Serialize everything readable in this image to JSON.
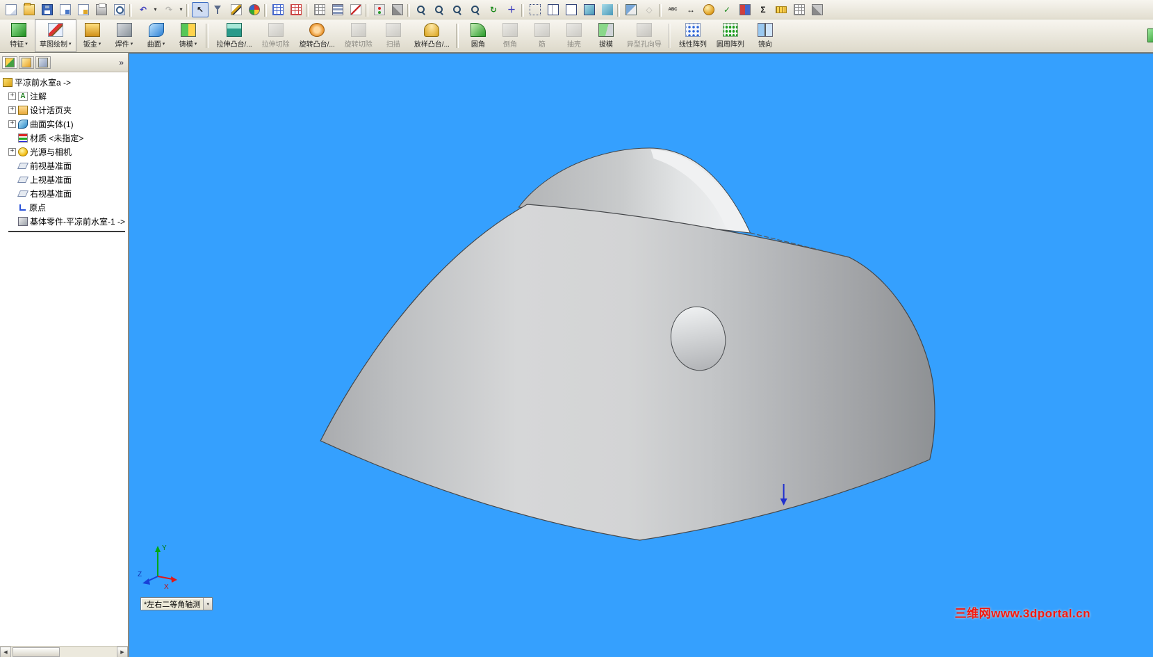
{
  "colors": {
    "viewport_bg": "#35a0fe",
    "watermark_red": "#f5190f",
    "toolbar_bg": "#ece9d8",
    "model_gray": "#c6c8ca"
  },
  "toolbar_main": {
    "items": [
      {
        "name": "new-document-button",
        "icon": "page",
        "icon_name": "new-document-icon"
      },
      {
        "name": "open-button",
        "icon": "folder",
        "icon_name": "open-folder-icon"
      },
      {
        "name": "save-button",
        "icon": "floppy",
        "icon_name": "save-icon"
      },
      {
        "name": "make-drawing-button",
        "icon": "page-blue",
        "icon_name": "make-drawing-icon"
      },
      {
        "name": "make-assembly-button",
        "icon": "page-gold",
        "icon_name": "make-assembly-icon"
      },
      {
        "name": "print-button",
        "icon": "printer",
        "icon_name": "print-icon"
      },
      {
        "name": "print-preview-button",
        "icon": "preview",
        "icon_name": "print-preview-icon",
        "sep": true
      },
      {
        "name": "undo-button",
        "icon": "none",
        "icon_name": "undo-icon",
        "glyph": "↶",
        "g": "blue",
        "caret": true
      },
      {
        "name": "redo-button",
        "icon": "none",
        "icon_name": "redo-icon",
        "glyph": "↷",
        "g": "gray",
        "caret": true,
        "state": "disabled",
        "sep": true
      },
      {
        "name": "select-button",
        "icon": "none",
        "icon_name": "select-arrow-icon",
        "glyph": "↖",
        "g": "dark",
        "pressed": true
      },
      {
        "name": "selection-filter-button",
        "icon": "funnel",
        "icon_name": "selection-filter-icon"
      },
      {
        "name": "sketch-entity-button",
        "icon": "pencil",
        "icon_name": "pencil-icon"
      },
      {
        "name": "color-button",
        "icon": "palette",
        "icon_name": "color-palette-icon",
        "sep": true
      },
      {
        "name": "design-table-button",
        "icon": "grid-blue",
        "icon_name": "design-table-icon"
      },
      {
        "name": "hole-table-button",
        "icon": "grid-red",
        "icon_name": "hole-table-icon",
        "sep": true
      },
      {
        "name": "equations-table-button",
        "icon": "grid-gray",
        "icon_name": "equations-table-icon"
      },
      {
        "name": "layers-button",
        "icon": "layers",
        "icon_name": "layers-icon"
      },
      {
        "name": "line-format-button",
        "icon": "diag",
        "icon_name": "line-format-icon",
        "sep": true
      },
      {
        "name": "rebuild-button",
        "icon": "rebuild",
        "icon_name": "rebuild-stoplight-icon"
      },
      {
        "name": "options-button",
        "icon": "hammer",
        "icon_name": "options-tools-icon",
        "sep": true
      },
      {
        "name": "zoom-previous-button",
        "icon": "mag",
        "icon_name": "zoom-previous-icon"
      },
      {
        "name": "zoom-to-fit-button",
        "icon": "mag",
        "icon_name": "zoom-to-fit-icon"
      },
      {
        "name": "zoom-to-area-button",
        "icon": "mag",
        "icon_name": "zoom-to-area-icon"
      },
      {
        "name": "zoom-in-out-button",
        "icon": "mag",
        "icon_name": "zoom-in-out-icon"
      },
      {
        "name": "rotate-view-button",
        "icon": "none",
        "icon_name": "rotate-view-icon",
        "glyph": "↻",
        "g": "green"
      },
      {
        "name": "pan-button",
        "icon": "none",
        "icon_name": "pan-icon",
        "glyph": "＋",
        "g": "blue",
        "sep": true
      },
      {
        "name": "wireframe-button",
        "icon": "box-wire",
        "icon_name": "wireframe-icon"
      },
      {
        "name": "hidden-lines-visible-button",
        "icon": "box-hlv",
        "icon_name": "hidden-lines-visible-icon"
      },
      {
        "name": "hidden-lines-removed-button",
        "icon": "box-hlr",
        "icon_name": "hidden-lines-removed-icon"
      },
      {
        "name": "shaded-with-edges-button",
        "icon": "box-shaded-e",
        "icon_name": "shaded-with-edges-icon"
      },
      {
        "name": "shaded-button",
        "icon": "box-shaded",
        "icon_name": "shaded-icon",
        "sep": true
      },
      {
        "name": "section-view-button",
        "icon": "section",
        "icon_name": "section-view-icon"
      },
      {
        "name": "perspective-button",
        "icon": "none",
        "icon_name": "perspective-icon",
        "glyph": "◇",
        "g": "gray",
        "state": "disabled",
        "sep": true
      },
      {
        "name": "spell-check-button",
        "icon": "abc",
        "icon_name": "spell-check-icon",
        "glyph": "ABC",
        "g": "dark"
      },
      {
        "name": "dimension-button",
        "icon": "none",
        "icon_name": "dimension-icon",
        "glyph": "↔",
        "g": "dark"
      },
      {
        "name": "appearance-button",
        "icon": "sphere",
        "icon_name": "appearance-sphere-icon"
      },
      {
        "name": "design-check-button",
        "icon": "none",
        "icon_name": "check-mark-icon",
        "glyph": "✓",
        "g": "green"
      },
      {
        "name": "swap-color-button",
        "icon": "redblue",
        "icon_name": "two-color-icon"
      },
      {
        "name": "equations-button",
        "icon": "none",
        "icon_name": "sigma-icon",
        "glyph": "Σ",
        "g": "dark"
      },
      {
        "name": "measure-button",
        "icon": "ruler",
        "icon_name": "measure-ruler-icon"
      },
      {
        "name": "mass-properties-button",
        "icon": "grid-gray",
        "icon_name": "mass-properties-icon"
      },
      {
        "name": "toolbox-button",
        "icon": "hammer",
        "icon_name": "toolbox-hammer-icon"
      }
    ]
  },
  "command_bar": {
    "tabs": [
      {
        "name": "tab-features",
        "label": "特征",
        "icon": "features",
        "icon_name": "features-icon",
        "caret": true
      },
      {
        "name": "tab-sketch",
        "label": "草图绘制",
        "icon": "sketch",
        "icon_name": "sketch-icon",
        "caret": true,
        "active": true
      },
      {
        "name": "tab-sheet-metal",
        "label": "钣金",
        "icon": "sheetmetal",
        "icon_name": "sheet-metal-icon",
        "caret": true
      },
      {
        "name": "tab-weldments",
        "label": "焊件",
        "icon": "weldments",
        "icon_name": "weldments-icon",
        "caret": true
      },
      {
        "name": "tab-surfaces",
        "label": "曲面",
        "icon": "surfaces",
        "icon_name": "surfaces-icon",
        "caret": true
      },
      {
        "name": "tab-mold",
        "label": "铸模",
        "icon": "mold",
        "icon_name": "mold-tools-icon",
        "caret": true,
        "sep": true
      }
    ],
    "commands": [
      {
        "name": "extruded-boss-button",
        "label": "拉伸凸台/...",
        "icon": "extrude-boss",
        "icon_name": "extruded-boss-icon"
      },
      {
        "name": "extruded-cut-button",
        "label": "拉伸切除",
        "icon": "generic",
        "icon_name": "extruded-cut-icon",
        "state": "disabled"
      },
      {
        "name": "revolved-boss-button",
        "label": "旋转凸台/...",
        "icon": "revolve-boss",
        "icon_name": "revolved-boss-icon"
      },
      {
        "name": "revolved-cut-button",
        "label": "旋转切除",
        "icon": "generic",
        "icon_name": "revolved-cut-icon",
        "state": "disabled"
      },
      {
        "name": "sweep-button",
        "label": "扫描",
        "icon": "generic",
        "icon_name": "sweep-icon",
        "state": "disabled"
      },
      {
        "name": "loft-button",
        "label": "放样凸台/...",
        "icon": "loft",
        "icon_name": "loft-icon",
        "sep": true
      },
      {
        "name": "fillet-button",
        "label": "圆角",
        "icon": "fillet",
        "icon_name": "fillet-icon"
      },
      {
        "name": "chamfer-button",
        "label": "倒角",
        "icon": "generic",
        "icon_name": "chamfer-icon",
        "state": "disabled"
      },
      {
        "name": "rib-button",
        "label": "筋",
        "icon": "generic",
        "icon_name": "rib-icon",
        "state": "disabled"
      },
      {
        "name": "shell-button",
        "label": "抽壳",
        "icon": "generic",
        "icon_name": "shell-icon",
        "state": "disabled"
      },
      {
        "name": "draft-button",
        "label": "拔模",
        "icon": "draft",
        "icon_name": "draft-icon"
      },
      {
        "name": "hole-wizard-button",
        "label": "异型孔向导",
        "icon": "holewiz",
        "icon_name": "hole-wizard-icon",
        "state": "disabled",
        "sep": true
      },
      {
        "name": "linear-pattern-button",
        "label": "线性阵列",
        "icon": "linear-pattern",
        "icon_name": "linear-pattern-icon"
      },
      {
        "name": "circular-pattern-button",
        "label": "圆周阵列",
        "icon": "circular-pattern",
        "icon_name": "circular-pattern-icon"
      },
      {
        "name": "mirror-button",
        "label": "镜向",
        "icon": "mirror",
        "icon_name": "mirror-icon"
      },
      {
        "name": "clipped-command-button",
        "label": "",
        "icon": "features",
        "icon_name": "clipped-command-icon",
        "clipped": true
      }
    ]
  },
  "panel": {
    "tabs": [
      {
        "name": "featuremanager-tab",
        "icon": "fm",
        "icon_name": "featuremanager-tree-icon",
        "active": true
      },
      {
        "name": "propertymanager-tab",
        "icon": "pm",
        "icon_name": "propertymanager-icon"
      },
      {
        "name": "configurationmanager-tab",
        "icon": "cm",
        "icon_name": "configurationmanager-icon"
      }
    ],
    "chevron": "»",
    "tree": {
      "root": {
        "name": "tree-root-item",
        "label": "平凉前水室a ->",
        "icon": "part",
        "icon_name": "part-icon"
      },
      "items": [
        {
          "name": "tree-item-annotations",
          "label": "注解",
          "icon": "annotations",
          "icon_name": "annotations-icon",
          "plus": true
        },
        {
          "name": "tree-item-design-binder",
          "label": "设计活页夹",
          "icon": "binder",
          "icon_name": "design-binder-icon",
          "plus": true
        },
        {
          "name": "tree-item-surface-bodies",
          "label": "曲面实体(1)",
          "icon": "surface",
          "icon_name": "surface-bodies-icon",
          "plus": true
        },
        {
          "name": "tree-item-material",
          "label": "材质 <未指定>",
          "icon": "material",
          "icon_name": "material-icon",
          "plus": false
        },
        {
          "name": "tree-item-lights-cameras",
          "label": "光源与相机",
          "icon": "lights",
          "icon_name": "lights-cameras-icon",
          "plus": true
        },
        {
          "name": "tree-item-front-plane",
          "label": "前视基准面",
          "icon": "plane",
          "icon_name": "plane-icon",
          "plus": false
        },
        {
          "name": "tree-item-top-plane",
          "label": "上视基准面",
          "icon": "plane",
          "icon_name": "plane-icon",
          "plus": false
        },
        {
          "name": "tree-item-right-plane",
          "label": "右视基准面",
          "icon": "plane",
          "icon_name": "plane-icon",
          "plus": false
        },
        {
          "name": "tree-item-origin",
          "label": "原点",
          "icon": "origin",
          "icon_name": "origin-icon",
          "plus": false
        },
        {
          "name": "tree-item-base-part",
          "label": "基体零件-平凉前水室-1 ->",
          "icon": "basepart",
          "icon_name": "base-part-icon",
          "plus": false
        }
      ]
    },
    "scrollbar": {
      "left": "◀",
      "right": "▶"
    }
  },
  "viewport": {
    "view_label": "*左右二等角轴测",
    "watermark": "三维网www.3dportal.cn",
    "triad": {
      "x": "X",
      "y": "Y",
      "z": "Z"
    }
  }
}
